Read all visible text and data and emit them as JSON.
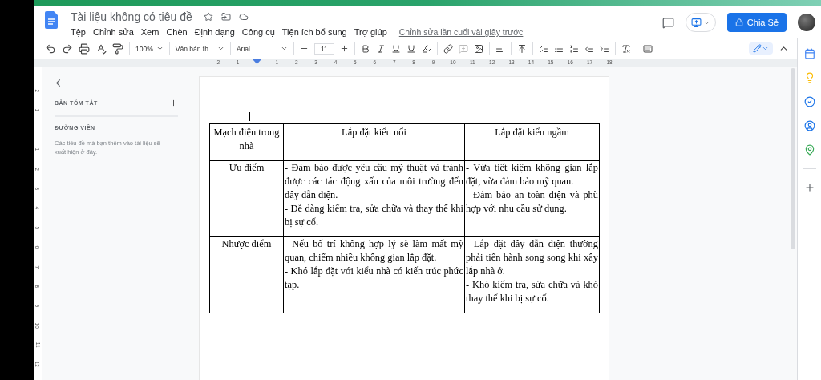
{
  "app_bar": {
    "title": "Tài liệu không có tiêu đề",
    "menu": [
      "Tệp",
      "Chỉnh sửa",
      "Xem",
      "Chèn",
      "Định dạng",
      "Công cụ",
      "Tiện ích bổ sung",
      "Trợ giúp"
    ],
    "last_edit": "Chỉnh sửa lần cuối vài giây trước",
    "share": "Chia Sẻ"
  },
  "toolbar": {
    "zoom": "100%",
    "style": "Văn bản th...",
    "font": "Arial",
    "font_size": "11"
  },
  "ruler": {
    "before": [
      "2",
      "1"
    ],
    "after": [
      "1",
      "2",
      "3",
      "4",
      "5",
      "6",
      "7",
      "8",
      "9",
      "10",
      "11",
      "12",
      "13",
      "14",
      "15",
      "16",
      "17",
      "18"
    ]
  },
  "vertical_ruler": {
    "before": [
      "2",
      "1"
    ],
    "after": [
      "1",
      "2",
      "3",
      "4",
      "5",
      "6",
      "7",
      "8",
      "9",
      "10",
      "11",
      "12"
    ]
  },
  "outline": {
    "summary_heading": "BẢN TÓM TẮT",
    "outline_heading": "ĐƯỜNG VIỀN",
    "empty_hint": "Các tiêu đề mà bạn thêm vào tài liệu sẽ xuất hiện ở đây."
  },
  "table": {
    "columns": [
      "Mạch điện trong nhà",
      "Lắp đặt kiểu nổi",
      "Lắp đặt kiểu ngầm"
    ],
    "rows": [
      {
        "cells": [
          [
            "Ưu điểm"
          ],
          [
            "- Đảm bảo được yêu cầu mỹ thuật và tránh được các tác động xấu của môi trường đến dây dẫn điện.",
            "- Dễ dàng kiểm tra, sửa chữa và thay thế khi bị sự cố."
          ],
          [
            "- Vừa tiết kiệm không gian lắp đặt, vừa đảm bảo mỹ quan.",
            "- Đảm bảo an toàn điện và phù hợp với nhu cầu sử dụng."
          ]
        ]
      },
      {
        "cells": [
          [
            "Nhược điểm"
          ],
          [
            "- Nếu bố trí không hợp lý sẽ làm mất mỹ quan, chiếm nhiều không gian lắp đặt.",
            "- Khó lắp đặt với kiểu nhà có kiến trúc phức tạp."
          ],
          [
            "- Lắp đặt dây dẫn điện thường phải tiến hành song song khi xây lắp nhà ở.",
            "- Khó kiểm tra, sửa chữa và khó thay thế khi bị sự cố."
          ]
        ]
      }
    ]
  }
}
